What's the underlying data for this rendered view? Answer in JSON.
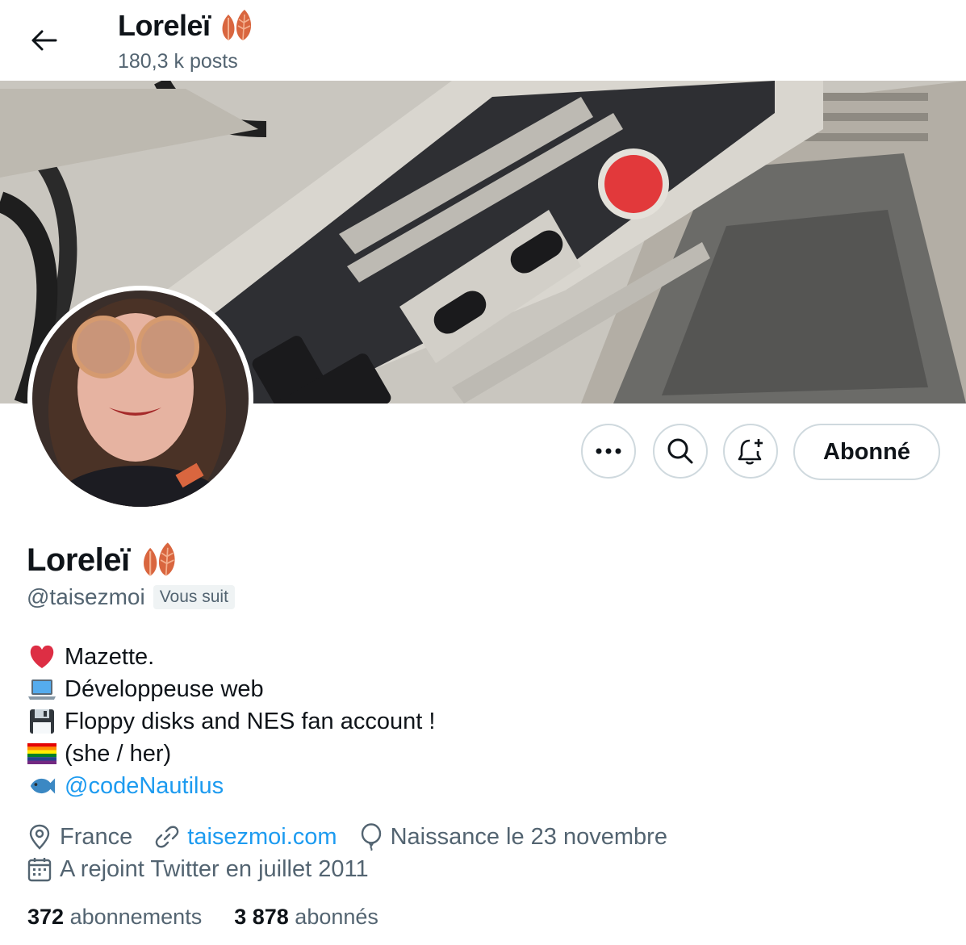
{
  "header": {
    "title": "Loreleï",
    "posts_count": "180,3 k posts",
    "back_icon": "arrow-left-icon"
  },
  "actions": {
    "more_icon": "more-icon",
    "search_icon": "search-icon",
    "notify_icon": "bell-plus-icon",
    "follow_label": "Abonné"
  },
  "profile": {
    "name": "Loreleï",
    "handle": "@taisezmoi",
    "follows_you": "Vous suit"
  },
  "bio": {
    "lines": [
      {
        "icon": "heart-icon",
        "text": "Mazette."
      },
      {
        "icon": "laptop-icon",
        "text": "Développeuse web"
      },
      {
        "icon": "floppy-disk-icon",
        "text": "Floppy disks and NES fan account !"
      },
      {
        "icon": "rainbow-flag-icon",
        "text": "(she / her)"
      },
      {
        "icon": "fish-icon",
        "text": "@codeNautilus"
      }
    ]
  },
  "meta": {
    "location": "France",
    "website": "taisezmoi.com",
    "birthday": "Naissance le 23 novembre",
    "joined": "A rejoint Twitter en juillet 2011"
  },
  "stats": {
    "following_count": "372",
    "following_label": "abonnements",
    "followers_count": "3 878",
    "followers_label": "abonnés"
  },
  "colors": {
    "link": "#1d9bf0",
    "secondary_text": "#536471",
    "border": "#cfd9de",
    "leaf": "#d9663f"
  }
}
